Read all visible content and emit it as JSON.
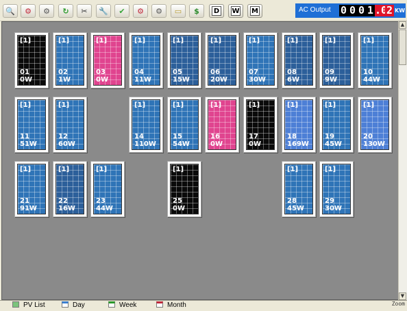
{
  "toolbar": {
    "buttons": [
      {
        "icon": "magnifier-icon",
        "glyph": "🔍"
      },
      {
        "icon": "inverter-red-icon",
        "glyph": "⚙"
      },
      {
        "icon": "inverter-grey-icon",
        "glyph": "⚙"
      },
      {
        "icon": "refresh-icon",
        "glyph": "↻"
      },
      {
        "icon": "tools-icon",
        "glyph": "✂"
      },
      {
        "icon": "wrench-icon",
        "glyph": "🔧"
      },
      {
        "icon": "check-icon",
        "glyph": "✔"
      },
      {
        "icon": "inverter-red2-icon",
        "glyph": "⚙"
      },
      {
        "icon": "inverter-grey2-icon",
        "glyph": "⚙"
      },
      {
        "icon": "ruler-icon",
        "glyph": "▭"
      },
      {
        "icon": "money-icon",
        "glyph": "$"
      }
    ],
    "period_buttons": [
      "D",
      "W",
      "M"
    ]
  },
  "ac_output": {
    "label": "AC Output",
    "digits": [
      "0",
      "0",
      "0",
      "1",
      ".0",
      "2"
    ],
    "unit": "KW"
  },
  "panels": [
    {
      "label": "[1]",
      "num": "01",
      "power": "0W",
      "color": "black"
    },
    {
      "label": "[1]",
      "num": "02",
      "power": "1W",
      "color": "blue"
    },
    {
      "label": "[1]",
      "num": "03",
      "power": "0W",
      "color": "pink"
    },
    {
      "label": "[1]",
      "num": "04",
      "power": "11W",
      "color": "blue"
    },
    {
      "label": "[1]",
      "num": "05",
      "power": "15W",
      "color": "dblue"
    },
    {
      "label": "[1]",
      "num": "06",
      "power": "20W",
      "color": "dblue"
    },
    {
      "label": "[1]",
      "num": "07",
      "power": "30W",
      "color": "blue"
    },
    {
      "label": "[1]",
      "num": "08",
      "power": "6W",
      "color": "dblue"
    },
    {
      "label": "[1]",
      "num": "09",
      "power": "9W",
      "color": "dblue"
    },
    {
      "label": "[1]",
      "num": "10",
      "power": "44W",
      "color": "blue"
    },
    {
      "label": "[1]",
      "num": "11",
      "power": "51W",
      "color": "blue"
    },
    {
      "label": "[1]",
      "num": "12",
      "power": "60W",
      "color": "blue"
    },
    {
      "label": "[1]",
      "num": "14",
      "power": "110W",
      "color": "blue"
    },
    {
      "label": "[1]",
      "num": "15",
      "power": "54W",
      "color": "blue"
    },
    {
      "label": "[1]",
      "num": "16",
      "power": "0W",
      "color": "pink"
    },
    {
      "label": "[1]",
      "num": "17",
      "power": "0W",
      "color": "black"
    },
    {
      "label": "[1]",
      "num": "18",
      "power": "169W",
      "color": "lblue"
    },
    {
      "label": "[1]",
      "num": "19",
      "power": "45W",
      "color": "blue"
    },
    {
      "label": "[1]",
      "num": "20",
      "power": "130W",
      "color": "lblue"
    },
    {
      "label": "[1]",
      "num": "21",
      "power": "91W",
      "color": "blue"
    },
    {
      "label": "[1]",
      "num": "22",
      "power": "16W",
      "color": "dblue"
    },
    {
      "label": "[1]",
      "num": "23",
      "power": "44W",
      "color": "blue"
    },
    {
      "label": "[1]",
      "num": "25",
      "power": "0W",
      "color": "black"
    },
    {
      "label": "[1]",
      "num": "28",
      "power": "45W",
      "color": "blue"
    },
    {
      "label": "[1]",
      "num": "29",
      "power": "30W",
      "color": "blue"
    }
  ],
  "tabs": [
    "PV List",
    "Day",
    "Week",
    "Month"
  ],
  "zoom_label": "Zoom"
}
